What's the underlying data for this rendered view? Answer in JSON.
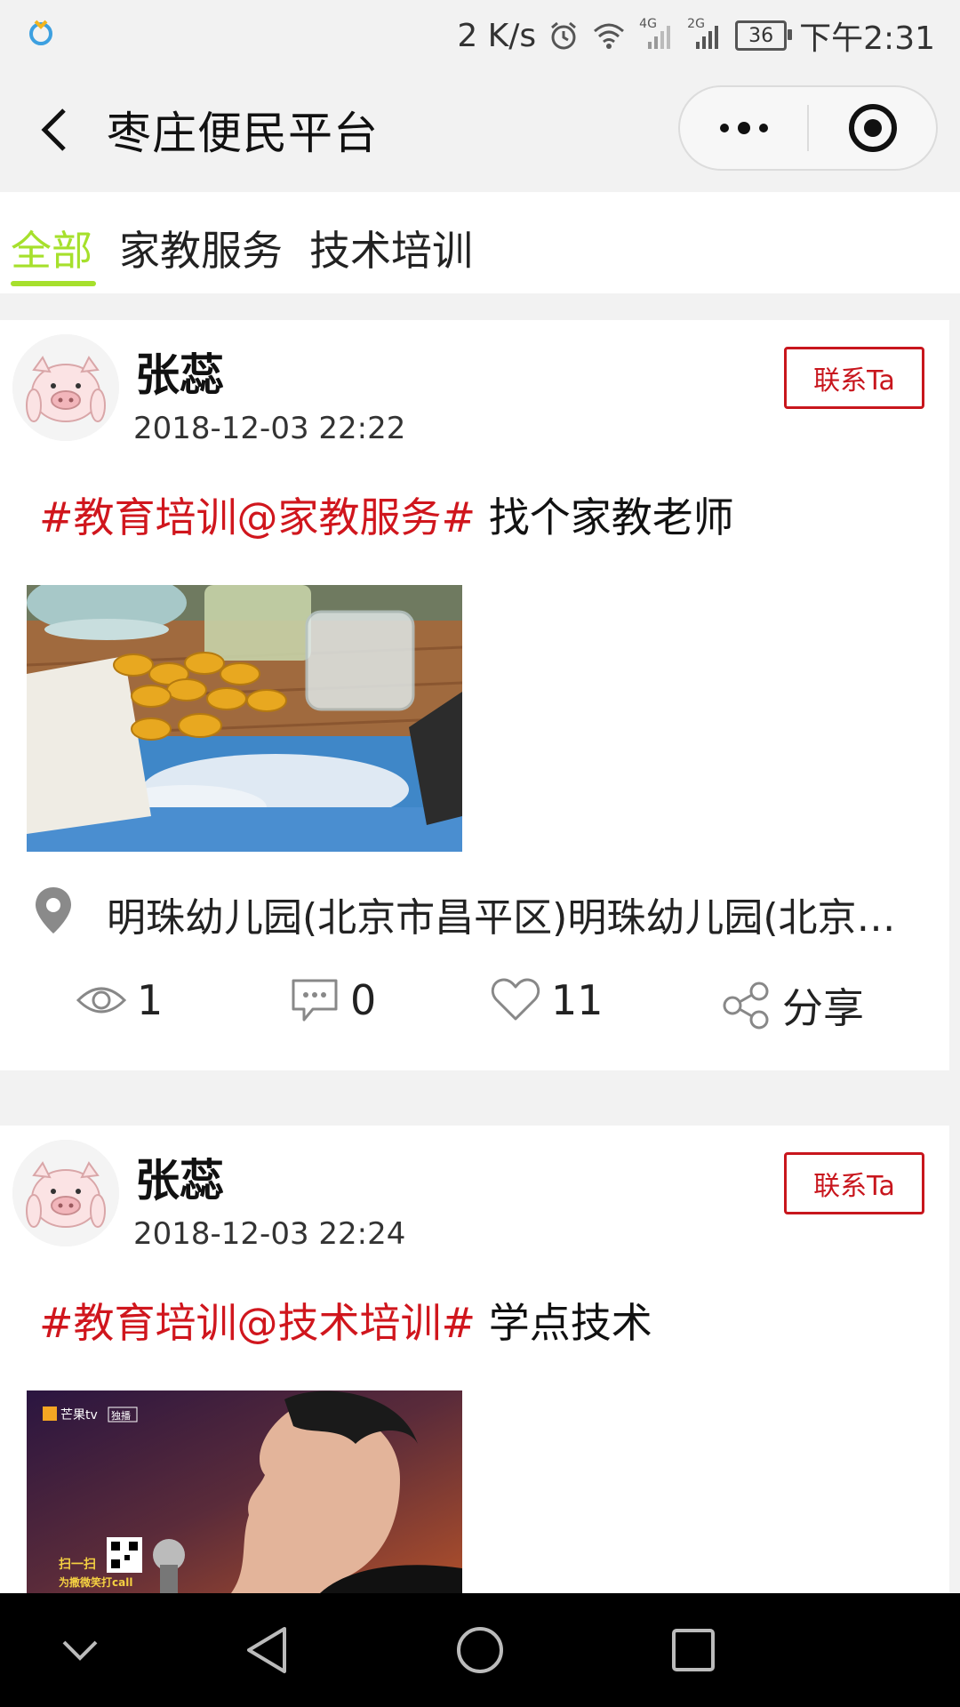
{
  "status_bar": {
    "net_speed": "2 K/s",
    "signal_4g": "4G",
    "signal_2g": "2G",
    "battery": "36",
    "time": "下午2:31"
  },
  "nav": {
    "title": "枣庄便民平台",
    "back_icon": "chevron-left-icon",
    "more_icon": "more-dots-icon",
    "close_icon": "target-circle-icon"
  },
  "tabs": [
    {
      "label": "全部",
      "active": true
    },
    {
      "label": "家教服务",
      "active": false
    },
    {
      "label": "技术培训",
      "active": false
    }
  ],
  "posts": [
    {
      "author": "张蕊",
      "time": "2018-12-03 22:22",
      "contact_label": "联系Ta",
      "tag": "#教育培训@家教服务#",
      "text": "找个家教老师",
      "location": "明珠幼儿园(北京市昌平区)明珠幼儿园(北京…",
      "views": "1",
      "comments": "0",
      "likes": "11",
      "share_label": "分享"
    },
    {
      "author": "张蕊",
      "time": "2018-12-03 22:24",
      "contact_label": "联系Ta",
      "tag": "#教育培训@技术培训#",
      "text": "学点技术",
      "image_overlay": {
        "logo_text": "芒果tv",
        "badge_text": "独播",
        "qr_caption_1": "扫一扫",
        "qr_caption_2": "为撒微笑打call"
      }
    }
  ],
  "colors": {
    "accent_green": "#a6e02c",
    "tag_red": "#d0161d",
    "contact_red": "#c8161d"
  }
}
